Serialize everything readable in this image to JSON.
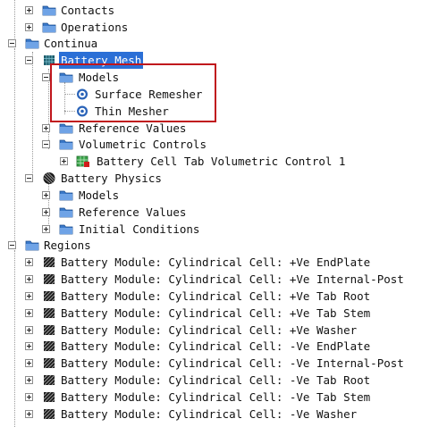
{
  "tree": {
    "contacts": "Contacts",
    "operations": "Operations",
    "continua": "Continua",
    "battery_mesh": "Battery Mesh",
    "models": "Models",
    "surface_remesher": "Surface Remesher",
    "thin_mesher": "Thin Mesher",
    "reference_values": "Reference Values",
    "volumetric_controls": "Volumetric Controls",
    "battery_cell_tab_vc1": "Battery Cell Tab Volumetric Control 1",
    "battery_physics": "Battery Physics",
    "physics_models": "Models",
    "physics_reference_values": "Reference Values",
    "initial_conditions": "Initial Conditions",
    "regions": "Regions",
    "region_items": [
      "Battery Module: Cylindrical Cell: +Ve EndPlate",
      "Battery Module: Cylindrical Cell: +Ve Internal-Post",
      "Battery Module: Cylindrical Cell: +Ve Tab Root",
      "Battery Module: Cylindrical Cell: +Ve Tab Stem",
      "Battery Module: Cylindrical Cell: +Ve Washer",
      "Battery Module: Cylindrical Cell: -Ve EndPlate",
      "Battery Module: Cylindrical Cell: -Ve Internal-Post",
      "Battery Module: Cylindrical Cell: -Ve Tab Root",
      "Battery Module: Cylindrical Cell: -Ve Tab Stem",
      "Battery Module: Cylindrical Cell: -Ve Washer"
    ]
  },
  "colors": {
    "selection": "#2b6fd6",
    "highlight_box": "#c0161c",
    "folder": "#3a78c9"
  },
  "icons": {
    "folder": "folder-icon",
    "mesh": "mesh-grid-icon",
    "model": "model-gear-icon",
    "control": "volumetric-control-icon",
    "physics": "physics-sphere-icon",
    "region": "region-hatched-icon"
  }
}
